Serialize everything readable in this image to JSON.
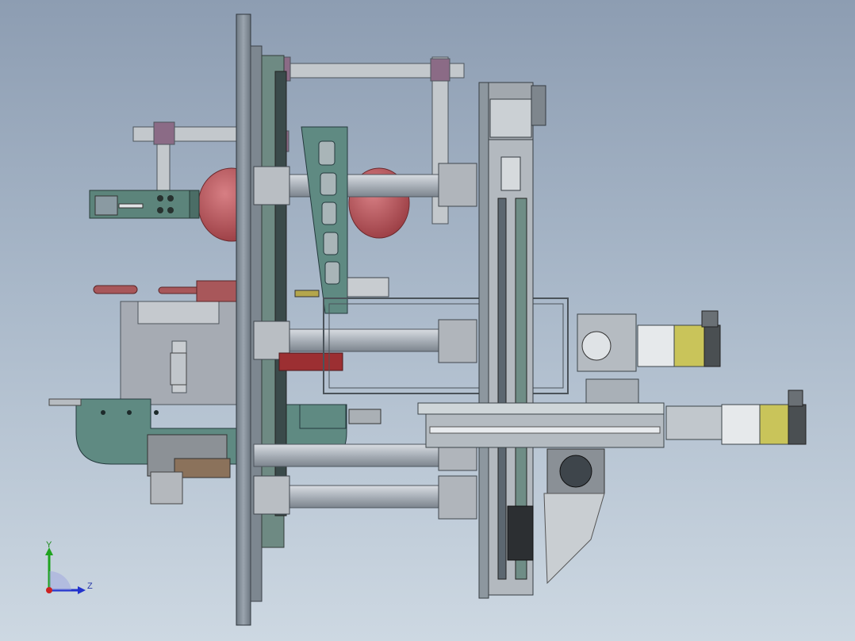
{
  "view": {
    "background_top": "#8d9db2",
    "background_bottom": "#cdd8e2"
  },
  "triad": {
    "y_label": "Y",
    "z_label": "Z",
    "y_color": "#1fa31f",
    "z_color": "#2233cc",
    "origin_color": "#cc2222"
  },
  "model": {
    "frame_color": "#9ba4ad",
    "plate_color": "#7f8a93",
    "teal_color": "#4f7d76",
    "red_color": "#b5484e",
    "motor_color": "#c9c45a"
  }
}
